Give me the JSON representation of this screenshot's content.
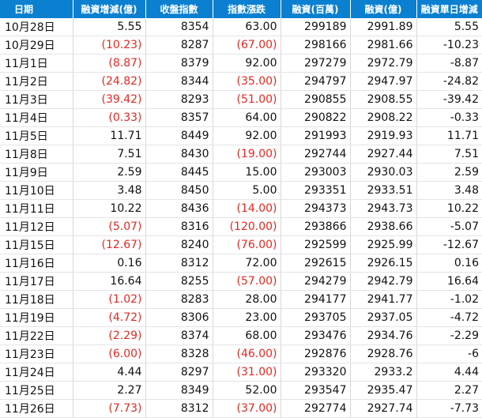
{
  "table": {
    "headers": [
      "日期",
      "融資增減(億)",
      "收盤指數",
      "指數漲跌",
      "融資(百萬)",
      "融資(億)",
      "融資單日增減"
    ],
    "rows": [
      [
        "10月28日",
        "5.55",
        "8354",
        "63.00",
        "299189",
        "2991.89",
        "5.55"
      ],
      [
        "10月29日",
        "(10.23)",
        "8287",
        "(67.00)",
        "298166",
        "2981.66",
        "-10.23"
      ],
      [
        "11月1日",
        "(8.87)",
        "8379",
        "92.00",
        "297279",
        "2972.79",
        "-8.87"
      ],
      [
        "11月2日",
        "(24.82)",
        "8344",
        "(35.00)",
        "294797",
        "2947.97",
        "-24.82"
      ],
      [
        "11月3日",
        "(39.42)",
        "8293",
        "(51.00)",
        "290855",
        "2908.55",
        "-39.42"
      ],
      [
        "11月4日",
        "(0.33)",
        "8357",
        "64.00",
        "290822",
        "2908.22",
        "-0.33"
      ],
      [
        "11月5日",
        "11.71",
        "8449",
        "92.00",
        "291993",
        "2919.93",
        "11.71"
      ],
      [
        "11月8日",
        "7.51",
        "8430",
        "(19.00)",
        "292744",
        "2927.44",
        "7.51"
      ],
      [
        "11月9日",
        "2.59",
        "8445",
        "15.00",
        "293003",
        "2930.03",
        "2.59"
      ],
      [
        "11月10日",
        "3.48",
        "8450",
        "5.00",
        "293351",
        "2933.51",
        "3.48"
      ],
      [
        "11月11日",
        "10.22",
        "8436",
        "(14.00)",
        "294373",
        "2943.73",
        "10.22"
      ],
      [
        "11月12日",
        "(5.07)",
        "8316",
        "(120.00)",
        "293866",
        "2938.66",
        "-5.07"
      ],
      [
        "11月15日",
        "(12.67)",
        "8240",
        "(76.00)",
        "292599",
        "2925.99",
        "-12.67"
      ],
      [
        "11月16日",
        "0.16",
        "8312",
        "72.00",
        "292615",
        "2926.15",
        "0.16"
      ],
      [
        "11月17日",
        "16.64",
        "8255",
        "(57.00)",
        "294279",
        "2942.79",
        "16.64"
      ],
      [
        "11月18日",
        "(1.02)",
        "8283",
        "28.00",
        "294177",
        "2941.77",
        "-1.02"
      ],
      [
        "11月19日",
        "(4.72)",
        "8306",
        "23.00",
        "293705",
        "2937.05",
        "-4.72"
      ],
      [
        "11月22日",
        "(2.29)",
        "8374",
        "68.00",
        "293476",
        "2934.76",
        "-2.29"
      ],
      [
        "11月23日",
        "(6.00)",
        "8328",
        "(46.00)",
        "292876",
        "2928.76",
        "-6"
      ],
      [
        "11月24日",
        "4.44",
        "8297",
        "(31.00)",
        "293320",
        "2933.2",
        "4.44"
      ],
      [
        "11月25日",
        "2.27",
        "8349",
        "52.00",
        "293547",
        "2935.47",
        "2.27"
      ],
      [
        "11月26日",
        "(7.73)",
        "8312",
        "(37.00)",
        "292774",
        "2927.74",
        "-7.73"
      ]
    ]
  },
  "colors": {
    "header_background": "#0b7fd0",
    "header_text": "#ffffff",
    "negative_text": "#e8261f",
    "normal_text": "#111111"
  }
}
